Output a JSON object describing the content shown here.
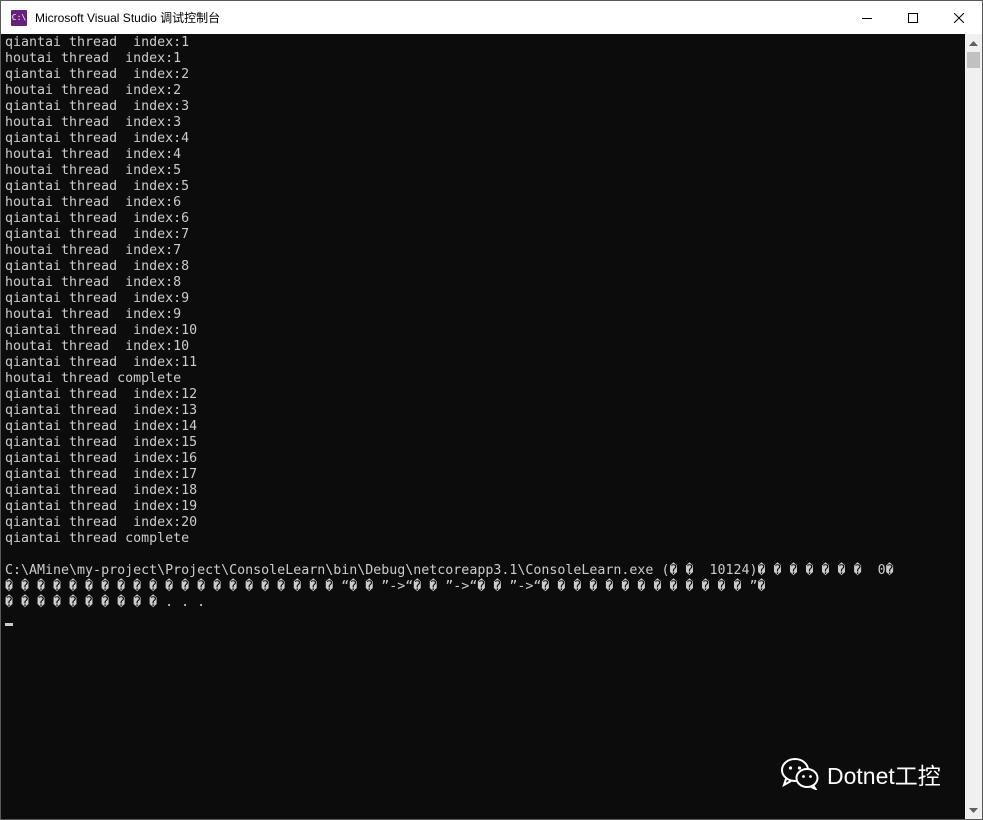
{
  "window": {
    "title": "Microsoft Visual Studio 调试控制台",
    "app_icon_text": "C:\\",
    "controls": [
      "minimize-icon",
      "maximize-icon",
      "close-icon"
    ]
  },
  "console": {
    "lines": [
      "qiantai thread  index:1",
      "houtai thread  index:1",
      "qiantai thread  index:2",
      "houtai thread  index:2",
      "qiantai thread  index:3",
      "houtai thread  index:3",
      "qiantai thread  index:4",
      "houtai thread  index:4",
      "houtai thread  index:5",
      "qiantai thread  index:5",
      "houtai thread  index:6",
      "qiantai thread  index:6",
      "qiantai thread  index:7",
      "houtai thread  index:7",
      "qiantai thread  index:8",
      "houtai thread  index:8",
      "qiantai thread  index:9",
      "houtai thread  index:9",
      "qiantai thread  index:10",
      "houtai thread  index:10",
      "qiantai thread  index:11",
      "houtai thread complete",
      "qiantai thread  index:12",
      "qiantai thread  index:13",
      "qiantai thread  index:14",
      "qiantai thread  index:15",
      "qiantai thread  index:16",
      "qiantai thread  index:17",
      "qiantai thread  index:18",
      "qiantai thread  index:19",
      "qiantai thread  index:20",
      "qiantai thread complete",
      "",
      "C:\\AMine\\my-project\\Project\\ConsoleLearn\\bin\\Debug\\netcoreapp3.1\\ConsoleLearn.exe (� �  10124)� � � � � � �  0�",
      "� � � � � � � � � � � � � � � � � � � � � “� � ”->“� � ”->“� � ”->“� � � � � � � � � � � � � ”�",
      "� � � � � � � � � � . . ."
    ]
  },
  "watermark": {
    "text": "Dotnet工控",
    "icon": "wechat-icon"
  },
  "colors": {
    "console_bg": "#0c0c0c",
    "console_fg": "#cccccc",
    "titlebar_bg": "#ffffff",
    "app_icon": "#68217a"
  }
}
